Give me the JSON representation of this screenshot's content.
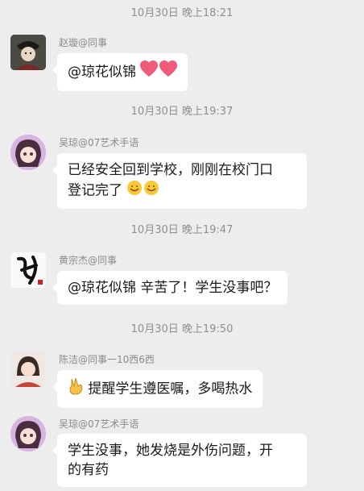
{
  "messages": [
    {
      "timestamp": "10月30日 晚上18:21",
      "sender": "赵璇@同事",
      "avatar_icon": "costume-figure-avatar-icon",
      "text": "@琼花似锦",
      "trailing_emoji": "two-hearts-icon"
    },
    {
      "timestamp": "10月30日 晚上19:37",
      "sender": "吴琼@07艺术手语",
      "avatar_icon": "cartoon-girl-avatar-icon",
      "text_line1": "已经安全回到学校，刚刚在校门口",
      "text_line2": "登记完了",
      "trailing_emoji": "smiling-face-icon"
    },
    {
      "timestamp": "10月30日 晚上19:47",
      "sender": "黄宗杰@同事",
      "avatar_icon": "calligraphy-avatar-icon",
      "text": "@琼花似锦  辛苦了！学生没事吧？"
    },
    {
      "timestamp": "10月30日 晚上19:50",
      "sender": "陈洁@同事一10西6西",
      "avatar_icon": "woman-photo-avatar-icon",
      "leading_emoji": "victory-hand-icon",
      "text": "提醒学生遵医嘱，多喝热水"
    },
    {
      "sender": "吴琼@07艺术手语",
      "avatar_icon": "cartoon-girl-avatar-icon",
      "text_line1": "学生没事，她发烧是外伤问题，开",
      "text_line2": "的有药"
    }
  ]
}
